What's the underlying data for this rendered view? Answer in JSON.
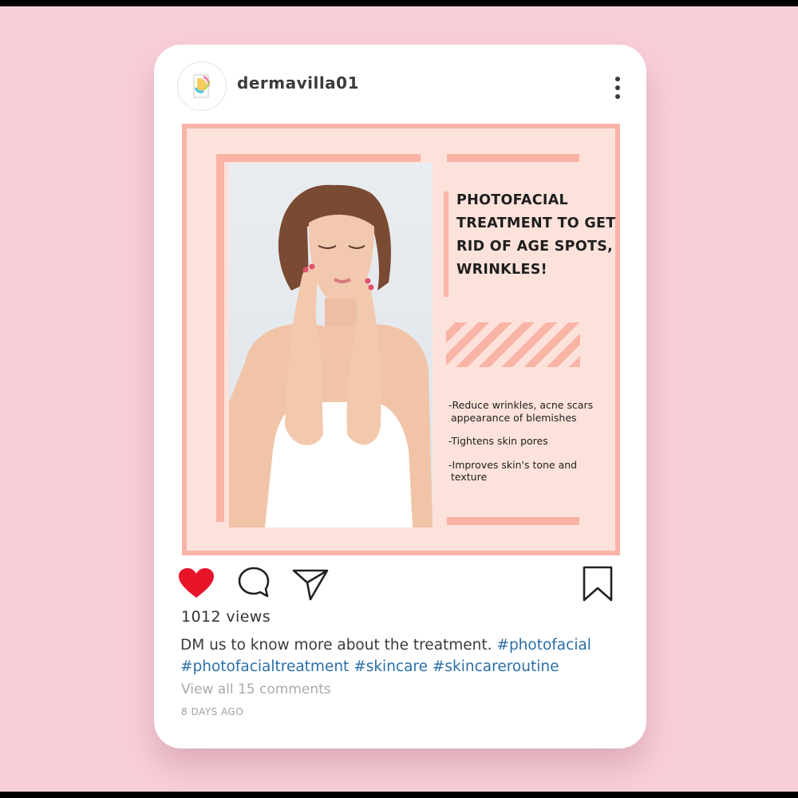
{
  "post": {
    "username": "dermavilla01",
    "avatar_icon": "dermavilla-logo-icon",
    "more_icon": "more-vertical-icon",
    "image": {
      "headline": "PHOTOFACIAL TREATMENT TO GET RID OF AGE SPOTS, WRINKLES!",
      "bullets": [
        "-Reduce wrinkles, acne scars appearance of blemishes",
        "-Tightens skin pores",
        "-Improves skin's tone and texture"
      ],
      "photo_subject": "woman-touching-face-photo"
    },
    "actions": {
      "like_icon": "heart-icon",
      "liked": true,
      "comment_icon": "comment-icon",
      "share_icon": "send-icon",
      "save_icon": "bookmark-icon"
    },
    "views": "1012 views",
    "caption": {
      "text": "DM us to know more about the treatment.",
      "hashtags": [
        "#photofacial",
        "#photofacialtreatment",
        "#skincare",
        "#skincareroutine"
      ]
    },
    "view_comments": "View all 15 comments",
    "timestamp": "8 DAYS AGO"
  },
  "colors": {
    "background": "#f9cfd9",
    "card": "#ffffff",
    "accent_salmon": "#f9b4a6",
    "panel_peach": "#fde2db",
    "heart": "#e8142a",
    "hashtag": "#2a6fa8"
  }
}
